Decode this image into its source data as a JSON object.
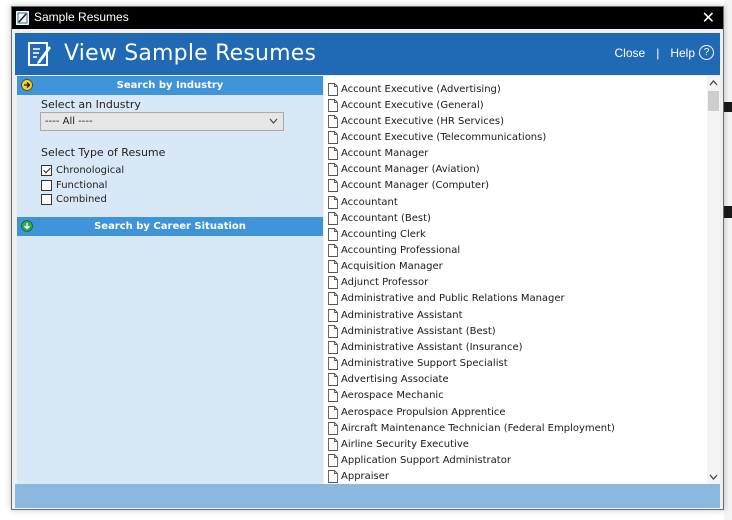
{
  "window": {
    "title": "Sample Resumes",
    "close_glyph": "✕"
  },
  "header": {
    "title": "View Sample Resumes",
    "close_label": "Close",
    "separator": "|",
    "help_label": "Help",
    "help_glyph": "?"
  },
  "industry_section": {
    "bar_label": "Search by Industry",
    "icon": "arrow-right-circle-icon",
    "select_label": "Select an Industry",
    "select_value": "---- All ----",
    "type_label": "Select Type of Resume",
    "types": [
      {
        "label": "Chronological",
        "checked": true
      },
      {
        "label": "Functional",
        "checked": false
      },
      {
        "label": "Combined",
        "checked": false
      }
    ]
  },
  "career_section": {
    "bar_label": "Search by Career Situation",
    "icon": "arrow-down-circle-icon"
  },
  "colors": {
    "header_blue": "#1f69b5",
    "section_bar": "#3f93d8",
    "left_panel": "#d9e8f6",
    "footer": "#8ab8de"
  },
  "resumes": [
    "Account Executive (Advertising)",
    "Account Executive (General)",
    "Account Executive (HR Services)",
    "Account Executive (Telecommunications)",
    "Account Manager",
    "Account Manager (Aviation)",
    "Account Manager (Computer)",
    "Accountant",
    "Accountant (Best)",
    "Accounting Clerk",
    "Accounting Professional",
    "Acquisition Manager",
    "Adjunct Professor",
    "Administrative and Public Relations Manager",
    "Administrative Assistant",
    "Administrative Assistant (Best)",
    "Administrative Assistant (Insurance)",
    "Administrative Support Specialist",
    "Advertising Associate",
    "Aerospace Mechanic",
    "Aerospace Propulsion Apprentice",
    "Aircraft Maintenance Technician (Federal Employment)",
    "Airline Security Executive",
    "Application Support Administrator",
    "Appraiser"
  ]
}
